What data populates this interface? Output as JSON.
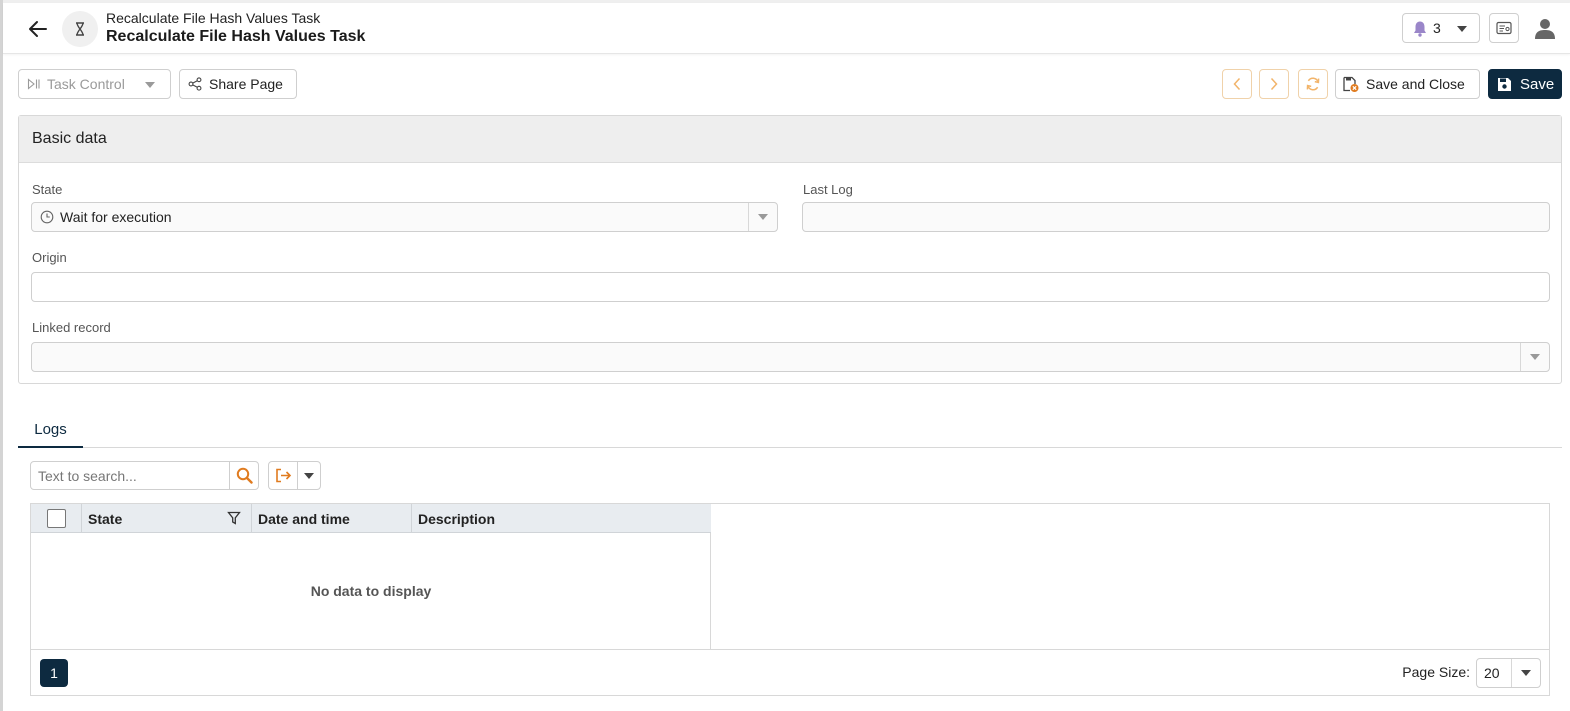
{
  "header": {
    "subtitle": "Recalculate File Hash Values Task",
    "title": "Recalculate File Hash Values Task",
    "notification_count": "3"
  },
  "toolbar": {
    "task_control_label": "Task Control",
    "share_label": "Share Page",
    "save_close_label": "Save and Close",
    "save_label": "Save"
  },
  "basic_data": {
    "title": "Basic data",
    "state_label": "State",
    "state_value": "Wait for execution",
    "last_log_label": "Last Log",
    "last_log_value": "",
    "origin_label": "Origin",
    "origin_value": "",
    "linked_record_label": "Linked record",
    "linked_record_value": ""
  },
  "tabs": [
    {
      "label": "Logs",
      "active": true
    }
  ],
  "logs": {
    "search_placeholder": "Text to search...",
    "columns": [
      "State",
      "Date and time",
      "Description"
    ],
    "rows": [],
    "empty_message": "No data to display",
    "current_page": "1",
    "page_size_label": "Page Size:",
    "page_size": "20"
  },
  "colors": {
    "primary": "#0d2a40",
    "accent": "#e07b1f",
    "notification_bell": "#9a86c9"
  },
  "icons": [
    "back-arrow-icon",
    "hourglass-icon",
    "bell-icon",
    "id-card-icon",
    "user-icon",
    "play-pause-icon",
    "share-icon",
    "chevron-left-icon",
    "chevron-right-icon",
    "refresh-icon",
    "save-close-icon",
    "save-icon",
    "clock-icon",
    "search-icon",
    "export-icon",
    "filter-icon"
  ]
}
